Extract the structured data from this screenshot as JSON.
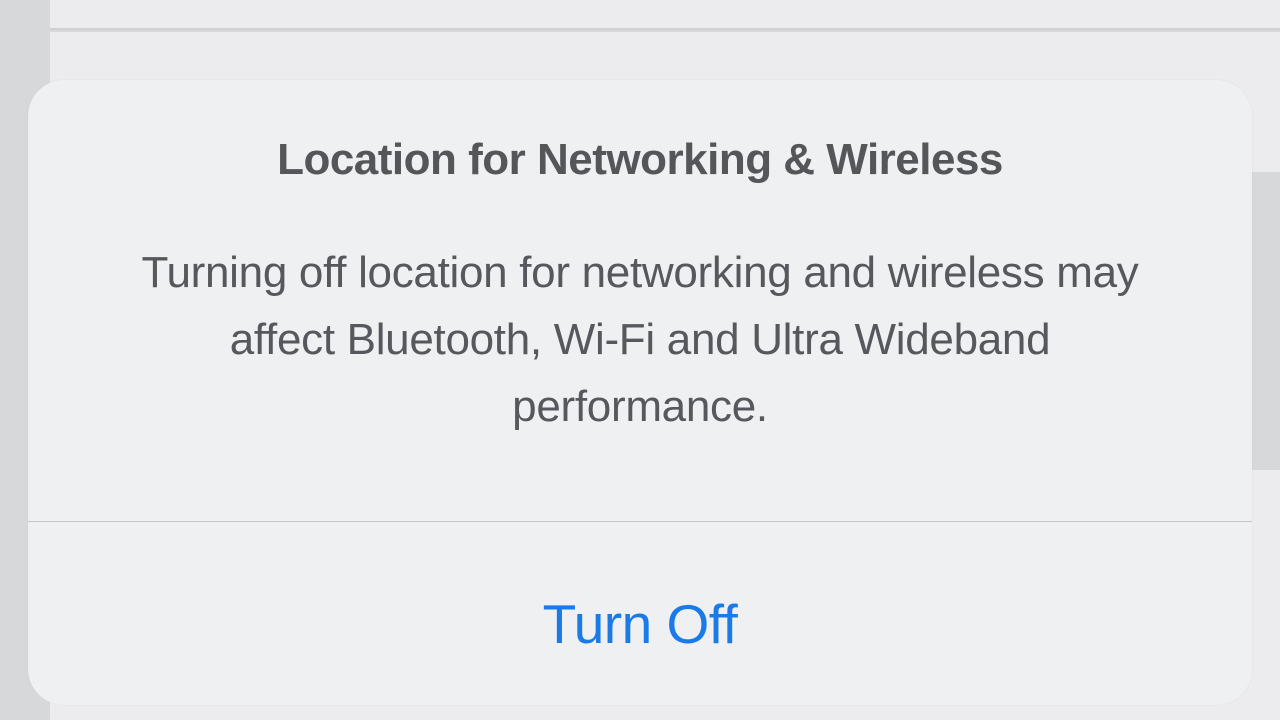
{
  "alert": {
    "title": "Location for Networking & Wireless",
    "message": "Turning off location for networking and wireless may affect Bluetooth, Wi-Fi and Ultra Wideband performance.",
    "button_label": "Turn Off"
  }
}
